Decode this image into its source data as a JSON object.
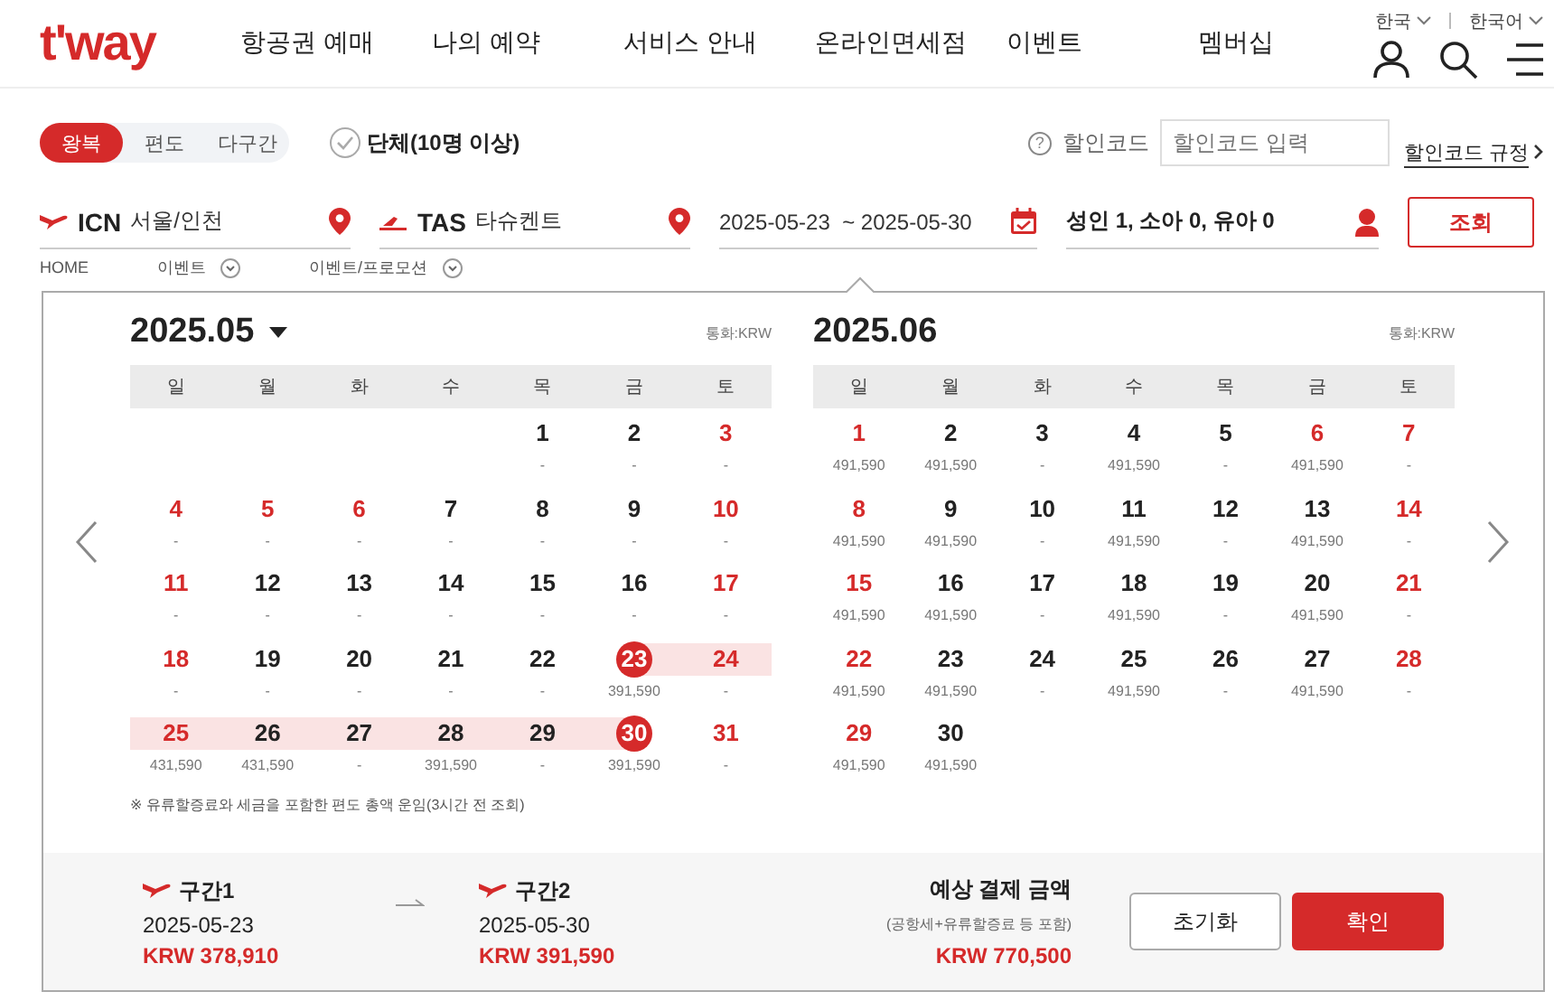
{
  "logo": "t'way",
  "nav": [
    "항공권 예매",
    "나의 예약",
    "서비스 안내",
    "온라인면세점",
    "이벤트",
    "멤버십"
  ],
  "utility": [
    "한국",
    "한국어"
  ],
  "trip_tabs": [
    {
      "label": "왕복",
      "selected": true
    },
    {
      "label": "편도",
      "selected": false
    },
    {
      "label": "다구간",
      "selected": false
    }
  ],
  "group_option": {
    "label": "단체(10명 이상)",
    "checked": false
  },
  "promo": {
    "help": "?",
    "label": "할인코드",
    "placeholder": "할인코드 입력",
    "link": "할인코드 규정"
  },
  "origin": {
    "code": "ICN",
    "city": "서울/인천"
  },
  "destination": {
    "code": "TAS",
    "city": "타슈켄트"
  },
  "dates": {
    "depart": "2025-05-23",
    "return": "~ 2025-05-30"
  },
  "passengers": "성인 1, 소아 0, 유아 0",
  "search_button": "조회",
  "breadcrumb": [
    "HOME",
    "이벤트",
    "이벤트/프로모션"
  ],
  "months": [
    {
      "title": "2025.05",
      "dropdown": true,
      "currency": "통화:KRW",
      "weekdays": [
        "일",
        "월",
        "화",
        "수",
        "목",
        "금",
        "토"
      ],
      "weeks": [
        [
          {
            "kind": "blank"
          },
          {
            "kind": "blank"
          },
          {
            "kind": "blank"
          },
          {
            "kind": "blank"
          },
          {
            "kind": "day",
            "day": "1",
            "price": "-",
            "holiday": false,
            "selected": false,
            "in_range": false
          },
          {
            "kind": "day",
            "day": "2",
            "price": "-",
            "holiday": false,
            "selected": false,
            "in_range": false
          },
          {
            "kind": "day",
            "day": "3",
            "price": "-",
            "holiday": true,
            "selected": false,
            "in_range": false
          }
        ],
        [
          {
            "kind": "day",
            "day": "4",
            "price": "-",
            "holiday": true,
            "selected": false,
            "in_range": false
          },
          {
            "kind": "day",
            "day": "5",
            "price": "-",
            "holiday": true,
            "selected": false,
            "in_range": false
          },
          {
            "kind": "day",
            "day": "6",
            "price": "-",
            "holiday": true,
            "selected": false,
            "in_range": false
          },
          {
            "kind": "day",
            "day": "7",
            "price": "-",
            "holiday": false,
            "selected": false,
            "in_range": false
          },
          {
            "kind": "day",
            "day": "8",
            "price": "-",
            "holiday": false,
            "selected": false,
            "in_range": false
          },
          {
            "kind": "day",
            "day": "9",
            "price": "-",
            "holiday": false,
            "selected": false,
            "in_range": false
          },
          {
            "kind": "day",
            "day": "10",
            "price": "-",
            "holiday": true,
            "selected": false,
            "in_range": false
          }
        ],
        [
          {
            "kind": "day",
            "day": "11",
            "price": "-",
            "holiday": true,
            "selected": false,
            "in_range": false
          },
          {
            "kind": "day",
            "day": "12",
            "price": "-",
            "holiday": false,
            "selected": false,
            "in_range": false
          },
          {
            "kind": "day",
            "day": "13",
            "price": "-",
            "holiday": false,
            "selected": false,
            "in_range": false
          },
          {
            "kind": "day",
            "day": "14",
            "price": "-",
            "holiday": false,
            "selected": false,
            "in_range": false
          },
          {
            "kind": "day",
            "day": "15",
            "price": "-",
            "holiday": false,
            "selected": false,
            "in_range": false
          },
          {
            "kind": "day",
            "day": "16",
            "price": "-",
            "holiday": false,
            "selected": false,
            "in_range": false
          },
          {
            "kind": "day",
            "day": "17",
            "price": "-",
            "holiday": true,
            "selected": false,
            "in_range": false
          }
        ],
        [
          {
            "kind": "day",
            "day": "18",
            "price": "-",
            "holiday": true,
            "selected": false,
            "in_range": false
          },
          {
            "kind": "day",
            "day": "19",
            "price": "-",
            "holiday": false,
            "selected": false,
            "in_range": false
          },
          {
            "kind": "day",
            "day": "20",
            "price": "-",
            "holiday": false,
            "selected": false,
            "in_range": false
          },
          {
            "kind": "day",
            "day": "21",
            "price": "-",
            "holiday": false,
            "selected": false,
            "in_range": false
          },
          {
            "kind": "day",
            "day": "22",
            "price": "-",
            "holiday": false,
            "selected": false,
            "in_range": false
          },
          {
            "kind": "day",
            "day": "23",
            "price": "391,590",
            "holiday": false,
            "selected": true,
            "in_range": true
          },
          {
            "kind": "day",
            "day": "24",
            "price": "-",
            "holiday": true,
            "selected": false,
            "in_range": true
          }
        ],
        [
          {
            "kind": "day",
            "day": "25",
            "price": "431,590",
            "holiday": true,
            "selected": false,
            "in_range": true
          },
          {
            "kind": "day",
            "day": "26",
            "price": "431,590",
            "holiday": false,
            "selected": false,
            "in_range": true
          },
          {
            "kind": "day",
            "day": "27",
            "price": "-",
            "holiday": false,
            "selected": false,
            "in_range": true
          },
          {
            "kind": "day",
            "day": "28",
            "price": "391,590",
            "holiday": false,
            "selected": false,
            "in_range": true
          },
          {
            "kind": "day",
            "day": "29",
            "price": "-",
            "holiday": false,
            "selected": false,
            "in_range": true
          },
          {
            "kind": "day",
            "day": "30",
            "price": "391,590",
            "holiday": false,
            "selected": true,
            "in_range": true
          },
          {
            "kind": "day",
            "day": "31",
            "price": "-",
            "holiday": true,
            "selected": false,
            "in_range": false
          }
        ]
      ]
    },
    {
      "title": "2025.06",
      "dropdown": false,
      "currency": "통화:KRW",
      "weekdays": [
        "일",
        "월",
        "화",
        "수",
        "목",
        "금",
        "토"
      ],
      "weeks": [
        [
          {
            "kind": "day",
            "day": "1",
            "price": "491,590",
            "holiday": true,
            "selected": false,
            "in_range": false
          },
          {
            "kind": "day",
            "day": "2",
            "price": "491,590",
            "holiday": false,
            "selected": false,
            "in_range": false
          },
          {
            "kind": "day",
            "day": "3",
            "price": "-",
            "holiday": false,
            "selected": false,
            "in_range": false
          },
          {
            "kind": "day",
            "day": "4",
            "price": "491,590",
            "holiday": false,
            "selected": false,
            "in_range": false
          },
          {
            "kind": "day",
            "day": "5",
            "price": "-",
            "holiday": false,
            "selected": false,
            "in_range": false
          },
          {
            "kind": "day",
            "day": "6",
            "price": "491,590",
            "holiday": true,
            "selected": false,
            "in_range": false
          },
          {
            "kind": "day",
            "day": "7",
            "price": "-",
            "holiday": true,
            "selected": false,
            "in_range": false
          }
        ],
        [
          {
            "kind": "day",
            "day": "8",
            "price": "491,590",
            "holiday": true,
            "selected": false,
            "in_range": false
          },
          {
            "kind": "day",
            "day": "9",
            "price": "491,590",
            "holiday": false,
            "selected": false,
            "in_range": false
          },
          {
            "kind": "day",
            "day": "10",
            "price": "-",
            "holiday": false,
            "selected": false,
            "in_range": false
          },
          {
            "kind": "day",
            "day": "11",
            "price": "491,590",
            "holiday": false,
            "selected": false,
            "in_range": false
          },
          {
            "kind": "day",
            "day": "12",
            "price": "-",
            "holiday": false,
            "selected": false,
            "in_range": false
          },
          {
            "kind": "day",
            "day": "13",
            "price": "491,590",
            "holiday": false,
            "selected": false,
            "in_range": false
          },
          {
            "kind": "day",
            "day": "14",
            "price": "-",
            "holiday": true,
            "selected": false,
            "in_range": false
          }
        ],
        [
          {
            "kind": "day",
            "day": "15",
            "price": "491,590",
            "holiday": true,
            "selected": false,
            "in_range": false
          },
          {
            "kind": "day",
            "day": "16",
            "price": "491,590",
            "holiday": false,
            "selected": false,
            "in_range": false
          },
          {
            "kind": "day",
            "day": "17",
            "price": "-",
            "holiday": false,
            "selected": false,
            "in_range": false
          },
          {
            "kind": "day",
            "day": "18",
            "price": "491,590",
            "holiday": false,
            "selected": false,
            "in_range": false
          },
          {
            "kind": "day",
            "day": "19",
            "price": "-",
            "holiday": false,
            "selected": false,
            "in_range": false
          },
          {
            "kind": "day",
            "day": "20",
            "price": "491,590",
            "holiday": false,
            "selected": false,
            "in_range": false
          },
          {
            "kind": "day",
            "day": "21",
            "price": "-",
            "holiday": true,
            "selected": false,
            "in_range": false
          }
        ],
        [
          {
            "kind": "day",
            "day": "22",
            "price": "491,590",
            "holiday": true,
            "selected": false,
            "in_range": false
          },
          {
            "kind": "day",
            "day": "23",
            "price": "491,590",
            "holiday": false,
            "selected": false,
            "in_range": false
          },
          {
            "kind": "day",
            "day": "24",
            "price": "-",
            "holiday": false,
            "selected": false,
            "in_range": false
          },
          {
            "kind": "day",
            "day": "25",
            "price": "491,590",
            "holiday": false,
            "selected": false,
            "in_range": false
          },
          {
            "kind": "day",
            "day": "26",
            "price": "-",
            "holiday": false,
            "selected": false,
            "in_range": false
          },
          {
            "kind": "day",
            "day": "27",
            "price": "491,590",
            "holiday": false,
            "selected": false,
            "in_range": false
          },
          {
            "kind": "day",
            "day": "28",
            "price": "-",
            "holiday": true,
            "selected": false,
            "in_range": false
          }
        ],
        [
          {
            "kind": "day",
            "day": "29",
            "price": "491,590",
            "holiday": true,
            "selected": false,
            "in_range": false
          },
          {
            "kind": "day",
            "day": "30",
            "price": "491,590",
            "holiday": false,
            "selected": false,
            "in_range": false
          },
          {
            "kind": "blank"
          },
          {
            "kind": "blank"
          },
          {
            "kind": "blank"
          },
          {
            "kind": "blank"
          },
          {
            "kind": "blank"
          }
        ]
      ]
    }
  ],
  "fare_note": "※ 유류할증료와 세금을 포함한 편도 총액 운임(3시간 전 조회)",
  "segments": [
    {
      "label": "구간1",
      "date": "2025-05-23",
      "price": "KRW 378,910"
    },
    {
      "label": "구간2",
      "date": "2025-05-30",
      "price": "KRW 391,590"
    }
  ],
  "total": {
    "label": "예상 결제 금액",
    "note": "(공항세+유류할증료 등 포함)",
    "amount": "KRW 770,500"
  },
  "actions": [
    "초기화",
    "확인"
  ]
}
